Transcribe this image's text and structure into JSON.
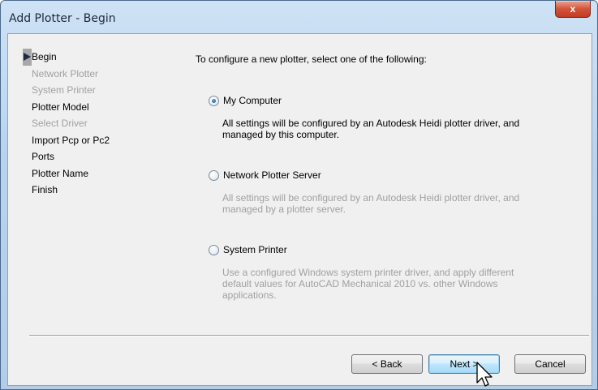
{
  "window": {
    "title": "Add Plotter - Begin",
    "close_label": "x"
  },
  "nav": {
    "current_index": 0,
    "items": [
      {
        "label": "Begin",
        "enabled": true,
        "current": true
      },
      {
        "label": "Network Plotter",
        "enabled": false
      },
      {
        "label": "System Printer",
        "enabled": false
      },
      {
        "label": "Plotter Model",
        "enabled": true
      },
      {
        "label": "Select Driver",
        "enabled": false
      },
      {
        "label": "Import Pcp or Pc2",
        "enabled": true
      },
      {
        "label": "Ports",
        "enabled": true
      },
      {
        "label": "Plotter Name",
        "enabled": true
      },
      {
        "label": "Finish",
        "enabled": true
      }
    ]
  },
  "content": {
    "intro": "To configure a new plotter, select one of the following:",
    "options": [
      {
        "label": "My Computer",
        "checked": true,
        "description": "All settings will be configured by an Autodesk Heidi plotter driver, and managed by this computer.",
        "description_enabled": true
      },
      {
        "label": "Network Plotter Server",
        "checked": false,
        "description": "All settings will be configured by an Autodesk Heidi plotter driver, and managed by a plotter server.",
        "description_enabled": false
      },
      {
        "label": "System Printer",
        "checked": false,
        "description": "Use a configured Windows system printer driver, and apply different default values for AutoCAD Mechanical 2010 vs. other Windows applications.",
        "description_enabled": false
      }
    ]
  },
  "buttons": {
    "back": "< Back",
    "next": "Next >",
    "cancel": "Cancel"
  },
  "icons": {
    "close": "close-icon",
    "current_step": "current-step-arrow-icon",
    "cursor": "mouse-pointer-icon"
  },
  "colors": {
    "title_bar": "#b9d3ee",
    "dialog_bg": "#f0f0f0",
    "close_button": "#c23b22",
    "disabled_text": "#a0a0a0",
    "default_button_border": "#3c7fb1"
  }
}
